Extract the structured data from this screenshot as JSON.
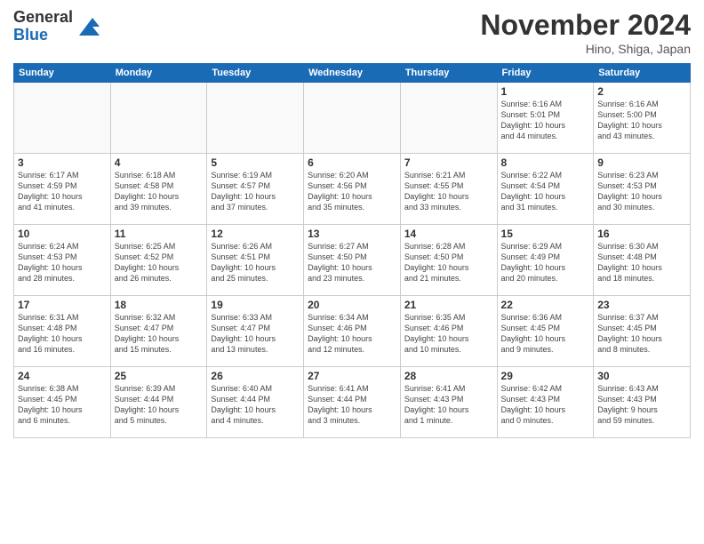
{
  "header": {
    "logo_line1": "General",
    "logo_line2": "Blue",
    "month": "November 2024",
    "location": "Hino, Shiga, Japan"
  },
  "weekdays": [
    "Sunday",
    "Monday",
    "Tuesday",
    "Wednesday",
    "Thursday",
    "Friday",
    "Saturday"
  ],
  "weeks": [
    [
      {
        "day": "",
        "info": ""
      },
      {
        "day": "",
        "info": ""
      },
      {
        "day": "",
        "info": ""
      },
      {
        "day": "",
        "info": ""
      },
      {
        "day": "",
        "info": ""
      },
      {
        "day": "1",
        "info": "Sunrise: 6:16 AM\nSunset: 5:01 PM\nDaylight: 10 hours\nand 44 minutes."
      },
      {
        "day": "2",
        "info": "Sunrise: 6:16 AM\nSunset: 5:00 PM\nDaylight: 10 hours\nand 43 minutes."
      }
    ],
    [
      {
        "day": "3",
        "info": "Sunrise: 6:17 AM\nSunset: 4:59 PM\nDaylight: 10 hours\nand 41 minutes."
      },
      {
        "day": "4",
        "info": "Sunrise: 6:18 AM\nSunset: 4:58 PM\nDaylight: 10 hours\nand 39 minutes."
      },
      {
        "day": "5",
        "info": "Sunrise: 6:19 AM\nSunset: 4:57 PM\nDaylight: 10 hours\nand 37 minutes."
      },
      {
        "day": "6",
        "info": "Sunrise: 6:20 AM\nSunset: 4:56 PM\nDaylight: 10 hours\nand 35 minutes."
      },
      {
        "day": "7",
        "info": "Sunrise: 6:21 AM\nSunset: 4:55 PM\nDaylight: 10 hours\nand 33 minutes."
      },
      {
        "day": "8",
        "info": "Sunrise: 6:22 AM\nSunset: 4:54 PM\nDaylight: 10 hours\nand 31 minutes."
      },
      {
        "day": "9",
        "info": "Sunrise: 6:23 AM\nSunset: 4:53 PM\nDaylight: 10 hours\nand 30 minutes."
      }
    ],
    [
      {
        "day": "10",
        "info": "Sunrise: 6:24 AM\nSunset: 4:53 PM\nDaylight: 10 hours\nand 28 minutes."
      },
      {
        "day": "11",
        "info": "Sunrise: 6:25 AM\nSunset: 4:52 PM\nDaylight: 10 hours\nand 26 minutes."
      },
      {
        "day": "12",
        "info": "Sunrise: 6:26 AM\nSunset: 4:51 PM\nDaylight: 10 hours\nand 25 minutes."
      },
      {
        "day": "13",
        "info": "Sunrise: 6:27 AM\nSunset: 4:50 PM\nDaylight: 10 hours\nand 23 minutes."
      },
      {
        "day": "14",
        "info": "Sunrise: 6:28 AM\nSunset: 4:50 PM\nDaylight: 10 hours\nand 21 minutes."
      },
      {
        "day": "15",
        "info": "Sunrise: 6:29 AM\nSunset: 4:49 PM\nDaylight: 10 hours\nand 20 minutes."
      },
      {
        "day": "16",
        "info": "Sunrise: 6:30 AM\nSunset: 4:48 PM\nDaylight: 10 hours\nand 18 minutes."
      }
    ],
    [
      {
        "day": "17",
        "info": "Sunrise: 6:31 AM\nSunset: 4:48 PM\nDaylight: 10 hours\nand 16 minutes."
      },
      {
        "day": "18",
        "info": "Sunrise: 6:32 AM\nSunset: 4:47 PM\nDaylight: 10 hours\nand 15 minutes."
      },
      {
        "day": "19",
        "info": "Sunrise: 6:33 AM\nSunset: 4:47 PM\nDaylight: 10 hours\nand 13 minutes."
      },
      {
        "day": "20",
        "info": "Sunrise: 6:34 AM\nSunset: 4:46 PM\nDaylight: 10 hours\nand 12 minutes."
      },
      {
        "day": "21",
        "info": "Sunrise: 6:35 AM\nSunset: 4:46 PM\nDaylight: 10 hours\nand 10 minutes."
      },
      {
        "day": "22",
        "info": "Sunrise: 6:36 AM\nSunset: 4:45 PM\nDaylight: 10 hours\nand 9 minutes."
      },
      {
        "day": "23",
        "info": "Sunrise: 6:37 AM\nSunset: 4:45 PM\nDaylight: 10 hours\nand 8 minutes."
      }
    ],
    [
      {
        "day": "24",
        "info": "Sunrise: 6:38 AM\nSunset: 4:45 PM\nDaylight: 10 hours\nand 6 minutes."
      },
      {
        "day": "25",
        "info": "Sunrise: 6:39 AM\nSunset: 4:44 PM\nDaylight: 10 hours\nand 5 minutes."
      },
      {
        "day": "26",
        "info": "Sunrise: 6:40 AM\nSunset: 4:44 PM\nDaylight: 10 hours\nand 4 minutes."
      },
      {
        "day": "27",
        "info": "Sunrise: 6:41 AM\nSunset: 4:44 PM\nDaylight: 10 hours\nand 3 minutes."
      },
      {
        "day": "28",
        "info": "Sunrise: 6:41 AM\nSunset: 4:43 PM\nDaylight: 10 hours\nand 1 minute."
      },
      {
        "day": "29",
        "info": "Sunrise: 6:42 AM\nSunset: 4:43 PM\nDaylight: 10 hours\nand 0 minutes."
      },
      {
        "day": "30",
        "info": "Sunrise: 6:43 AM\nSunset: 4:43 PM\nDaylight: 9 hours\nand 59 minutes."
      }
    ]
  ]
}
